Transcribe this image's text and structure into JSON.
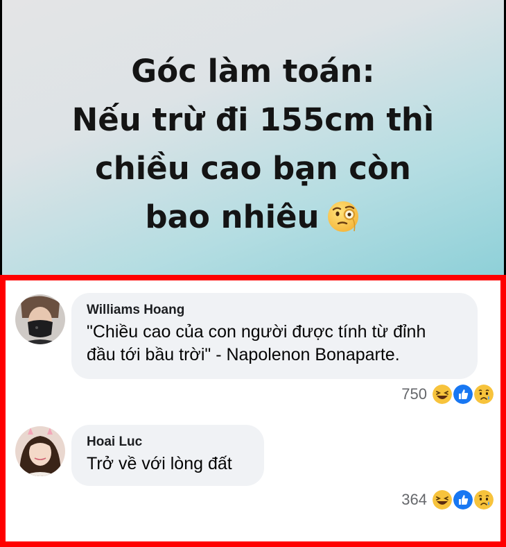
{
  "post": {
    "lines": [
      "Góc làm toán:",
      "Nếu trừ đi 155cm thì",
      "chiều cao bạn còn",
      "bao nhiêu"
    ],
    "emoji": "face-with-monocle-icon"
  },
  "highlight_color": "#ff0000",
  "comments": [
    {
      "author": "Williams Hoang",
      "text_line1": "\"Chiều cao của con người được tính từ đỉnh",
      "text_line2": "đầu tới bầu trời\" - Napolenon Bonaparte.",
      "reaction_count": "750",
      "reactions": [
        "haha-icon",
        "like-icon",
        "sad-icon"
      ]
    },
    {
      "author": "Hoai Luc",
      "text_line1": "Trở về với lòng đất",
      "reaction_count": "364",
      "reactions": [
        "haha-icon",
        "like-icon",
        "sad-icon"
      ]
    }
  ]
}
